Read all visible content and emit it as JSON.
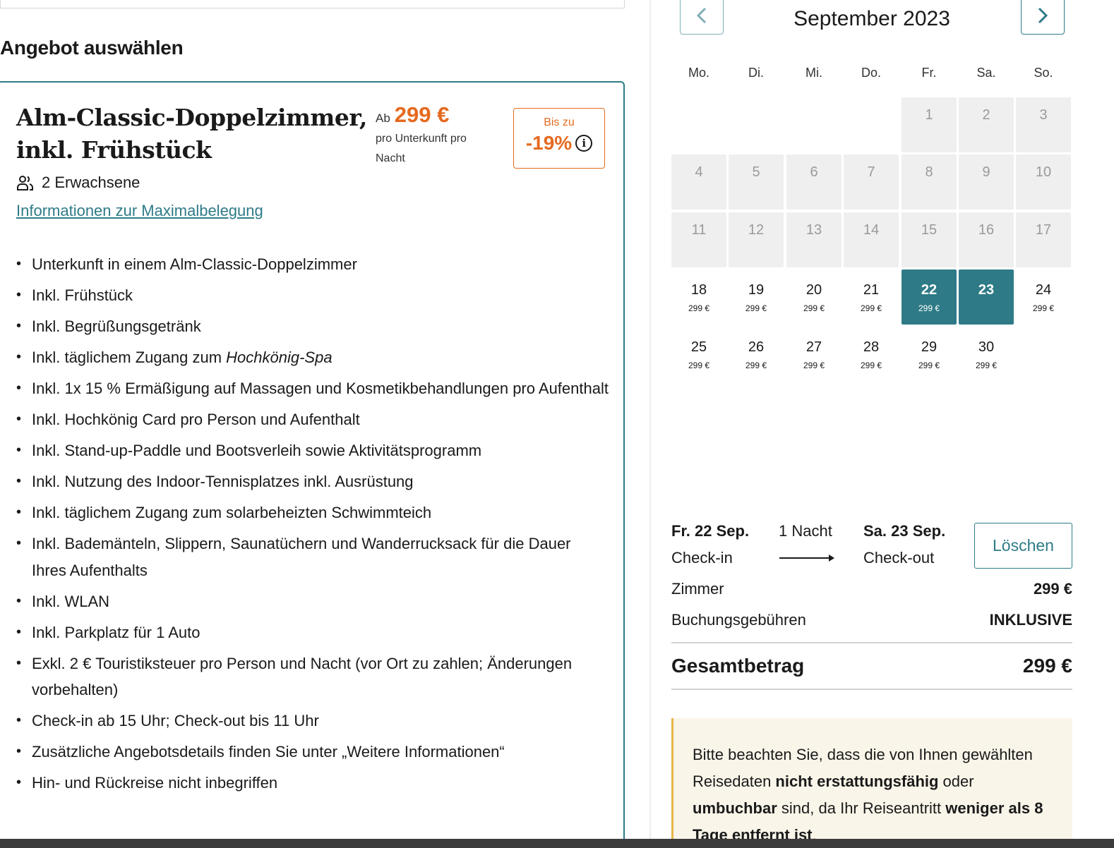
{
  "offer": {
    "section_heading": "Angebot auswählen",
    "title": "Alm-Classic-Doppelzimmer, inkl. Frühstück",
    "price_prefix": "Ab",
    "price": "299 €",
    "price_sub": "pro Unterkunft pro Nacht",
    "discount_label": "Bis zu",
    "discount_value": "-19%",
    "guests": "2 Erwachsene",
    "occupancy_link": "Informationen zur Maximalbelegung",
    "features": [
      {
        "text": "Unterkunft in einem Alm-Classic-Doppelzimmer"
      },
      {
        "text": "Inkl. Frühstück"
      },
      {
        "text": "Inkl. Begrüßungsgetränk"
      },
      {
        "prefix": "Inkl. täglichem Zugang zum ",
        "em": "Hochkönig-Spa"
      },
      {
        "text": "Inkl. 1x 15 % Ermäßigung auf Massagen und Kosmetikbehandlungen pro Aufenthalt"
      },
      {
        "text": "Inkl. Hochkönig Card pro Person und Aufenthalt"
      },
      {
        "text": "Inkl. Stand-up-Paddle und Bootsverleih sowie Aktivitätsprogramm"
      },
      {
        "text": "Inkl. Nutzung des Indoor-Tennisplatzes inkl. Ausrüstung"
      },
      {
        "text": "Inkl. täglichem Zugang zum solarbeheizten Schwimmteich"
      },
      {
        "text": "Inkl. Bademänteln, Slippern, Saunatüchern und Wanderrucksack für die Dauer Ihres Aufenthalts"
      },
      {
        "text": "Inkl. WLAN"
      },
      {
        "text": "Inkl. Parkplatz für 1 Auto"
      },
      {
        "text": "Exkl. 2 € Touristiksteuer pro Person und Nacht (vor Ort zu zahlen; Änderungen vorbehalten)"
      },
      {
        "text": "Check-in ab 15 Uhr; Check-out bis 11 Uhr"
      },
      {
        "text": "Zusätzliche Angebotsdetails finden Sie unter „Weitere Informationen“"
      },
      {
        "text": "Hin- und Rückreise nicht inbegriffen"
      }
    ]
  },
  "calendar": {
    "month_title": "September 2023",
    "weekdays": [
      "Mo.",
      "Di.",
      "Mi.",
      "Do.",
      "Fr.",
      "Sa.",
      "So."
    ],
    "first_weekday_index": 4,
    "days": [
      {
        "day": "1",
        "state": "disabled"
      },
      {
        "day": "2",
        "state": "disabled"
      },
      {
        "day": "3",
        "state": "disabled"
      },
      {
        "day": "4",
        "state": "disabled"
      },
      {
        "day": "5",
        "state": "disabled"
      },
      {
        "day": "6",
        "state": "disabled"
      },
      {
        "day": "7",
        "state": "disabled"
      },
      {
        "day": "8",
        "state": "disabled"
      },
      {
        "day": "9",
        "state": "disabled"
      },
      {
        "day": "10",
        "state": "disabled"
      },
      {
        "day": "11",
        "state": "disabled"
      },
      {
        "day": "12",
        "state": "disabled"
      },
      {
        "day": "13",
        "state": "disabled"
      },
      {
        "day": "14",
        "state": "disabled"
      },
      {
        "day": "15",
        "state": "disabled"
      },
      {
        "day": "16",
        "state": "disabled"
      },
      {
        "day": "17",
        "state": "disabled"
      },
      {
        "day": "18",
        "state": "available",
        "price": "299 €"
      },
      {
        "day": "19",
        "state": "available",
        "price": "299 €"
      },
      {
        "day": "20",
        "state": "available",
        "price": "299 €"
      },
      {
        "day": "21",
        "state": "available",
        "price": "299 €"
      },
      {
        "day": "22",
        "state": "selected",
        "price": "299 €"
      },
      {
        "day": "23",
        "state": "selected",
        "price": ""
      },
      {
        "day": "24",
        "state": "available",
        "price": "299 €"
      },
      {
        "day": "25",
        "state": "available",
        "price": "299 €"
      },
      {
        "day": "26",
        "state": "available",
        "price": "299 €"
      },
      {
        "day": "27",
        "state": "available",
        "price": "299 €"
      },
      {
        "day": "28",
        "state": "available",
        "price": "299 €"
      },
      {
        "day": "29",
        "state": "available",
        "price": "299 €"
      },
      {
        "day": "30",
        "state": "available",
        "price": "299 €"
      }
    ]
  },
  "summary": {
    "checkin_date": "Fr. 22 Sep.",
    "checkin_label": "Check-in",
    "nights": "1 Nacht",
    "checkout_date": "Sa. 23 Sep.",
    "checkout_label": "Check-out",
    "clear_label": "Löschen",
    "room_label": "Zimmer",
    "room_value": "299 €",
    "fees_label": "Buchungsgebühren",
    "fees_value": "INKLUSIVE",
    "total_label": "Gesamtbetrag",
    "total_value": "299 €"
  },
  "notice": {
    "t1": "Bitte beachten Sie, dass die von Ihnen gewählten Reisedaten ",
    "b1": "nicht erstattungsfähig",
    "t2": " oder ",
    "b2": "umbuchbar",
    "t3": " sind, da Ihr Reiseantritt ",
    "b3": "weniger als 8 Tage entfernt ist",
    "t4": "."
  },
  "colors": {
    "accent": "#2e7b87",
    "price_orange": "#e56a1f",
    "notice_bg": "#faf5e9",
    "notice_border": "#e8b548"
  },
  "icons": {
    "guests": "users-icon",
    "info": "info-icon",
    "prev": "chevron-left-icon",
    "next": "chevron-right-icon"
  }
}
